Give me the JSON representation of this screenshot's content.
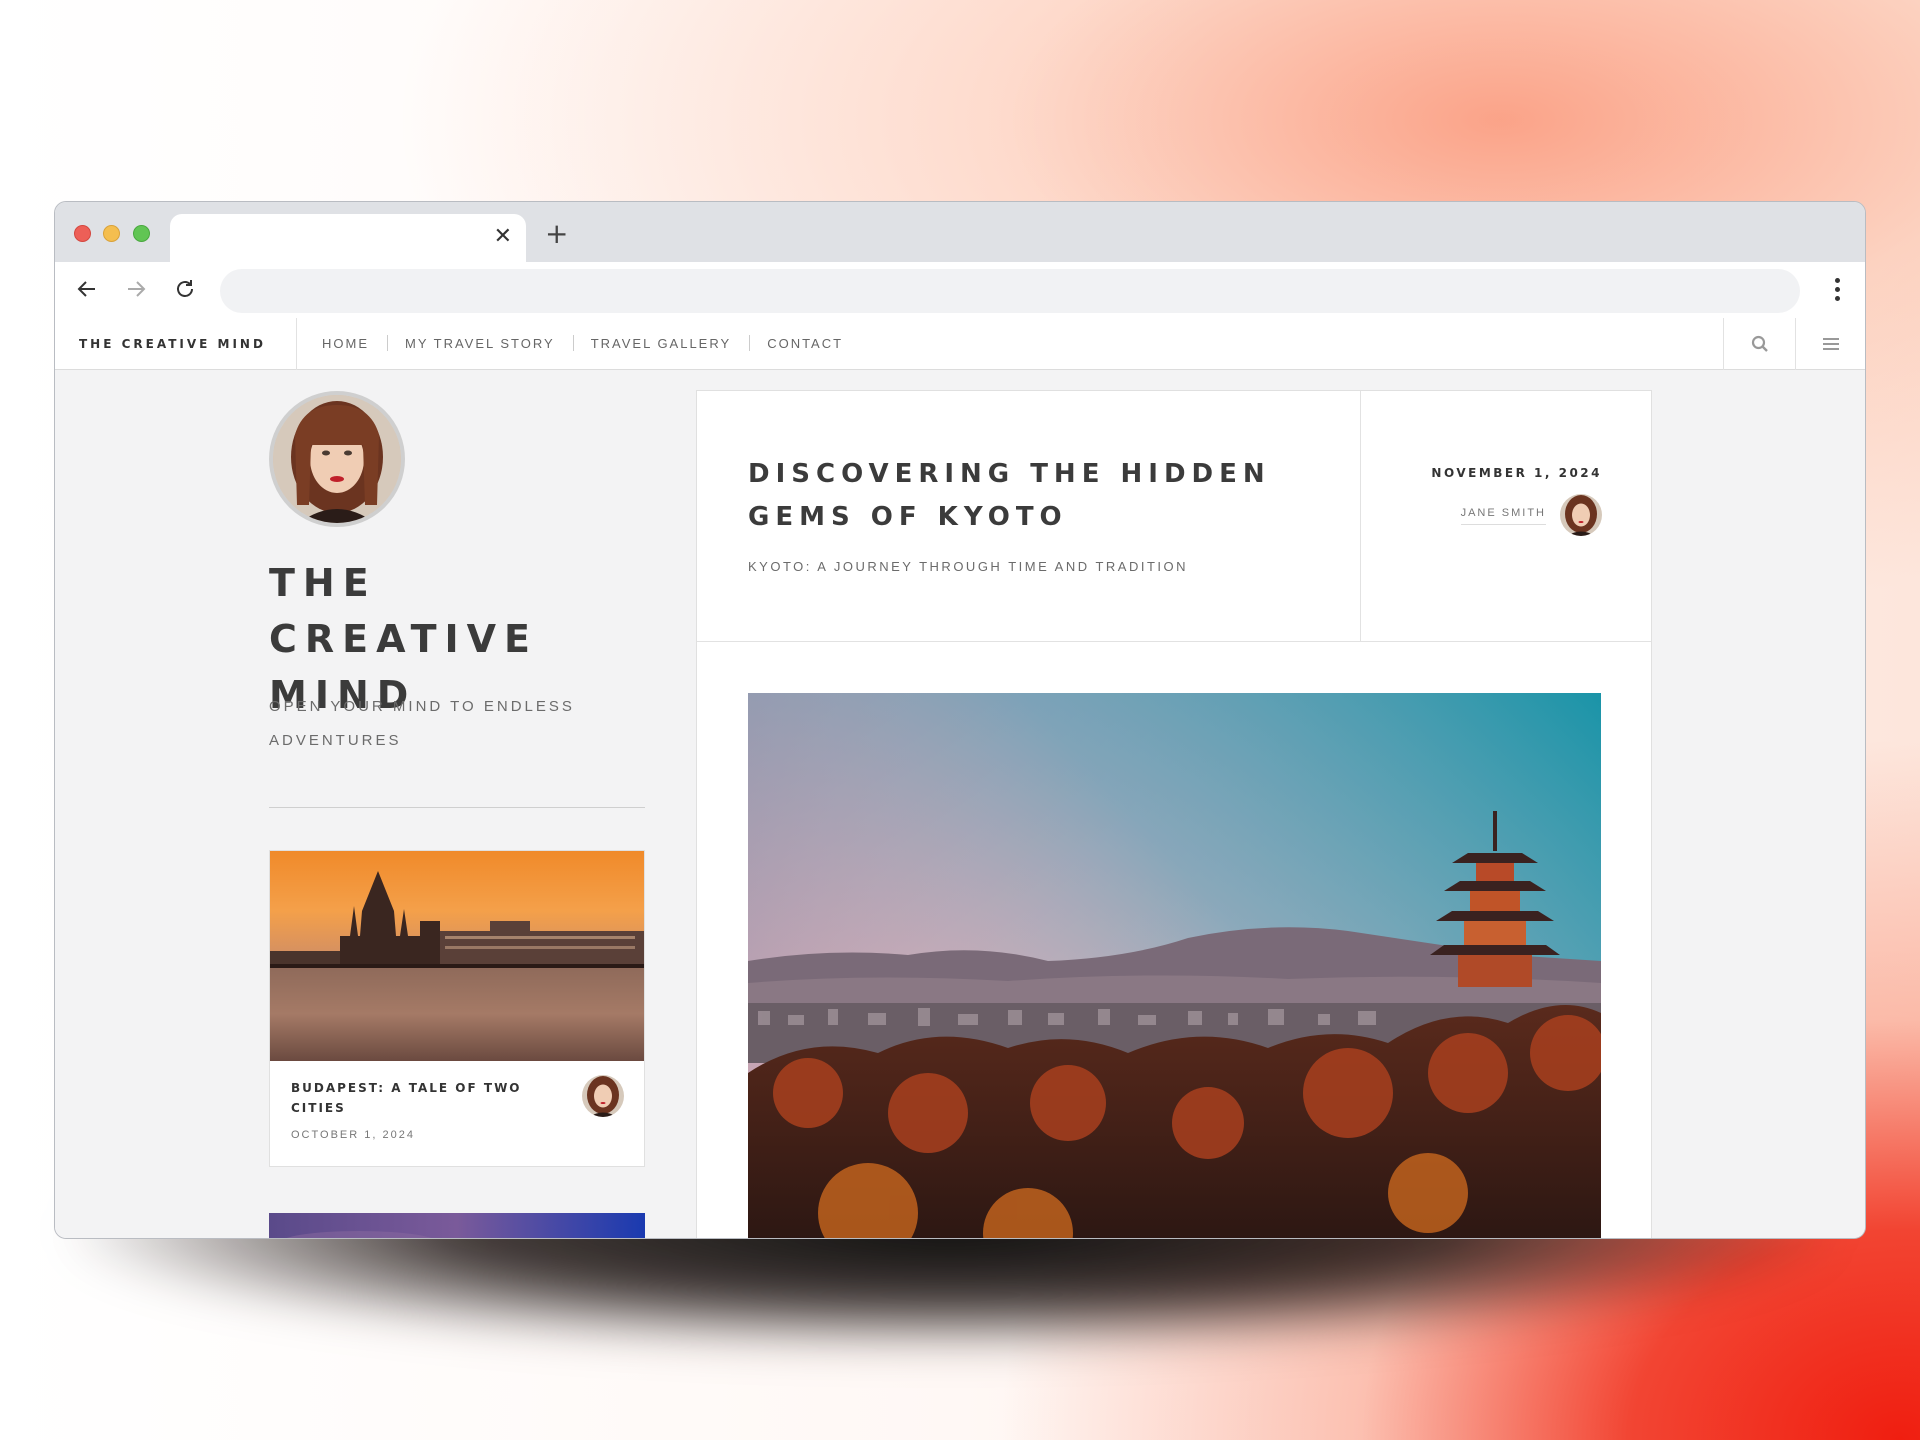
{
  "browser": {
    "tab_close": "✕",
    "new_tab": "+"
  },
  "site": {
    "brand": "THE CREATIVE MIND",
    "nav": [
      "HOME",
      "MY TRAVEL STORY",
      "TRAVEL GALLERY",
      "CONTACT"
    ]
  },
  "sidebar": {
    "title": "THE CREATIVE MIND",
    "tagline": "OPEN YOUR MIND TO ENDLESS ADVENTURES",
    "card": {
      "title": "BUDAPEST: A TALE OF TWO CITIES",
      "date": "OCTOBER 1, 2024"
    }
  },
  "post": {
    "title": "DISCOVERING THE HIDDEN GEMS OF KYOTO",
    "subtitle": "KYOTO: A JOURNEY THROUGH TIME AND TRADITION",
    "date": "NOVEMBER 1, 2024",
    "author": "JANE SMITH"
  },
  "colors": {
    "accent": "#3b3b3b",
    "page_bg": "#f3f3f4"
  }
}
